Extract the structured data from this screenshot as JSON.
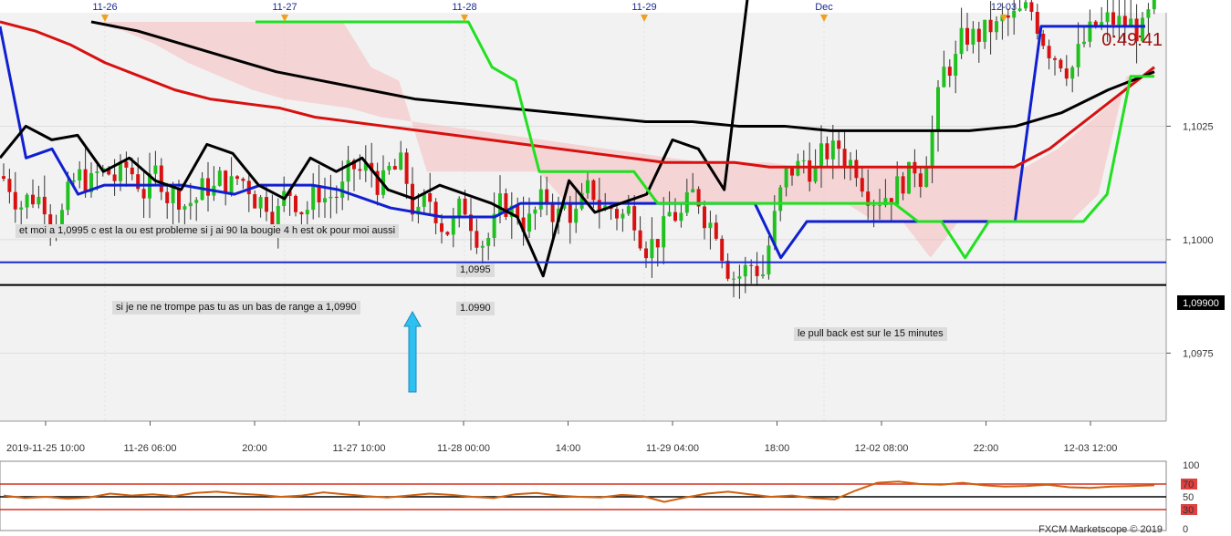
{
  "chart_data": {
    "type": "candlestick",
    "date_ticks_top": [
      "11-26",
      "11-27",
      "11-28",
      "11-29",
      "Dec",
      "12-03"
    ],
    "date_ticks_bottom": [
      "2019-11-25 10:00",
      "11-26 06:00",
      "20:00",
      "11-27 10:00",
      "11-28 00:00",
      "14:00",
      "11-29 04:00",
      "18:00",
      "12-02 08:00",
      "22:00",
      "12-03 12:00"
    ],
    "price_ticks": [
      "1,1025",
      "1,1000",
      "1,0975"
    ],
    "ylim": [
      1.096,
      1.105
    ],
    "price_badge": "1,09900",
    "countdown": "0:49:41",
    "horizontal_levels": [
      {
        "label": "1,0995",
        "value": 1.0995,
        "color": "#1a2ad0"
      },
      {
        "label": "1.0990",
        "value": 1.099,
        "color": "#000000"
      }
    ],
    "annotations": [
      {
        "text": "et moi a 1,0995 c est la ou est probleme si j ai 90 la bougie 4 h est ok pour moi aussi"
      },
      {
        "text": "si je ne ne trompe pas tu as un bas de range a 1,0990"
      },
      {
        "text": "le pull back est sur le 15 minutes"
      }
    ],
    "series": [
      {
        "values": [
          1.1047,
          1.1018,
          1.102,
          1.101,
          1.1012,
          1.1012,
          1.1012,
          1.1012,
          1.1011,
          1.101,
          1.1012,
          1.1012,
          1.1012,
          1.1011,
          1.1009,
          1.1007,
          1.1006,
          1.1005,
          1.1005,
          1.1005,
          1.1008,
          1.1008,
          1.1008,
          1.1008,
          1.1008,
          1.1008,
          1.1008,
          1.1008,
          1.1008,
          1.1008,
          1.0996,
          1.1004,
          1.1004,
          1.1004,
          1.1004,
          1.1004,
          1.1004,
          1.1004,
          1.1004,
          1.1004,
          1.1047,
          1.1047,
          1.1047,
          1.1047,
          1.1047
        ],
        "color": "#1020d0"
      },
      {
        "values": [
          1.1018,
          1.1025,
          1.1022,
          1.1023,
          1.1015,
          1.1018,
          1.1013,
          1.1011,
          1.1021,
          1.1019,
          1.1012,
          1.1009,
          1.1018,
          1.1015,
          1.1018,
          1.1011,
          1.1009,
          1.1012,
          1.101,
          1.1008,
          1.1005,
          1.0992,
          1.1013,
          1.1006,
          1.1008,
          1.101,
          1.1022,
          1.102,
          1.1011,
          1.1058
        ],
        "color": "#000000"
      },
      {
        "values": [
          1.1048,
          1.1046,
          1.1043,
          1.1039,
          1.1036,
          1.1033,
          1.1031,
          1.103,
          1.1029,
          1.1027,
          1.1026,
          1.1025,
          1.1024,
          1.1023,
          1.1022,
          1.1021,
          1.102,
          1.1019,
          1.1018,
          1.1017,
          1.1017,
          1.1017,
          1.1016,
          1.1016,
          1.1016,
          1.1016,
          1.1016,
          1.1016,
          1.1016,
          1.1016,
          1.102,
          1.1026,
          1.1032,
          1.1038
        ],
        "color": "#d81010"
      },
      {
        "values": [
          1.1048,
          1.1046,
          1.1043,
          1.104,
          1.1037,
          1.1035,
          1.1033,
          1.1031,
          1.103,
          1.1029,
          1.1028,
          1.1027,
          1.1026,
          1.1026,
          1.1025,
          1.1025,
          1.1024,
          1.1024,
          1.1024,
          1.1024,
          1.1025,
          1.1028,
          1.1033,
          1.1037
        ],
        "color": "#000000"
      },
      {
        "values": [
          1.1048,
          1.1048,
          1.1048,
          1.1048,
          1.1048,
          1.1048,
          1.1048,
          1.1048,
          1.1048,
          1.1048,
          1.1038,
          1.1035,
          1.1015,
          1.1015,
          1.1015,
          1.1015,
          1.1015,
          1.1008,
          1.1008,
          1.1008,
          1.1008,
          1.1008,
          1.1008,
          1.1008,
          1.1008,
          1.1008,
          1.1008,
          1.1008,
          1.1004,
          1.1004,
          1.0996,
          1.1004,
          1.1004,
          1.1004,
          1.1004,
          1.1004,
          1.101,
          1.1036,
          1.1036
        ],
        "color": "#20e020"
      }
    ],
    "oscillator": {
      "ticks": [
        "100",
        "70",
        "50",
        "30",
        "0"
      ],
      "levels": [
        70,
        50,
        30
      ],
      "values": [
        52,
        48,
        50,
        47,
        49,
        55,
        52,
        54,
        51,
        56,
        58,
        55,
        53,
        50,
        52,
        57,
        54,
        51,
        49,
        52,
        55,
        53,
        50,
        48,
        54,
        56,
        52,
        50,
        49,
        53,
        51,
        42,
        49,
        55,
        58,
        54,
        50,
        52,
        48,
        46,
        60,
        72,
        74,
        70,
        69,
        72,
        68,
        66,
        67,
        69,
        65,
        64,
        66,
        67,
        68
      ]
    },
    "footer": "FXCM Marketscope © 2019"
  }
}
